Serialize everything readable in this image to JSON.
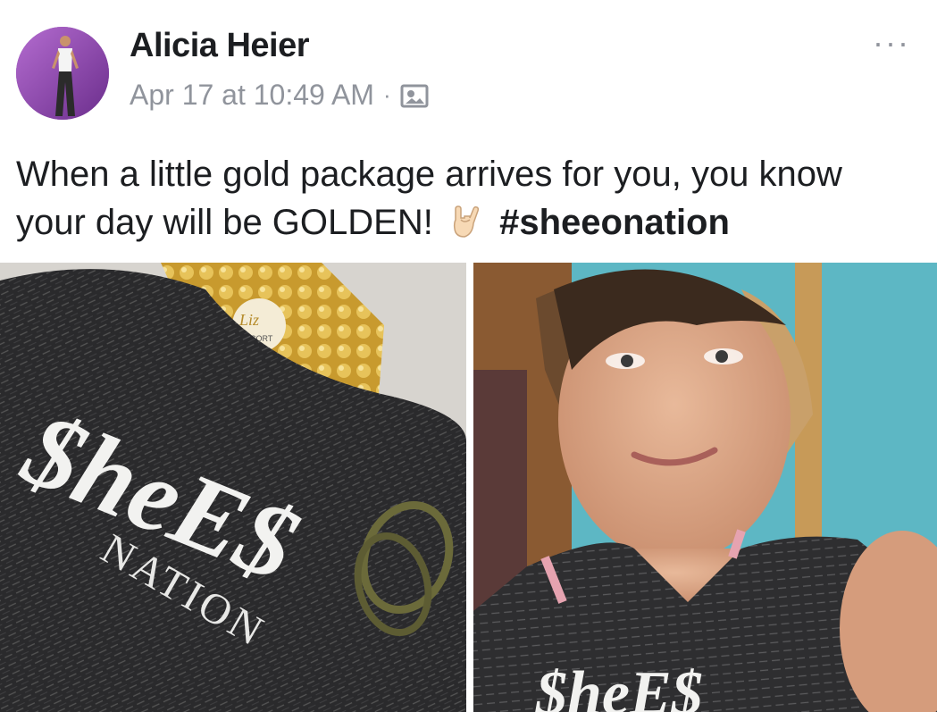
{
  "post": {
    "author": "Alicia Heier",
    "timestamp": "Apr 17 at 10:49 AM",
    "separator": "·",
    "audience_icon": "photo-icon",
    "more_icon": "more-horizontal-icon",
    "more_label": "···",
    "text_part1": "When a little gold package arrives for you, you know your day will be GOLDEN!",
    "emoji": "sign-of-the-horns-icon",
    "hashtag": "#sheeonation"
  },
  "photos": {
    "left": {
      "shirt_logo_text": "$heE$",
      "shirt_sub_text": "NATION",
      "package_brand": "Liz",
      "package_brand_sub": "CORT"
    },
    "right": {
      "shirt_logo_text": "$heE$"
    }
  },
  "colors": {
    "name": "#1c1e21",
    "meta": "#90949c",
    "background": "#ffffff"
  }
}
